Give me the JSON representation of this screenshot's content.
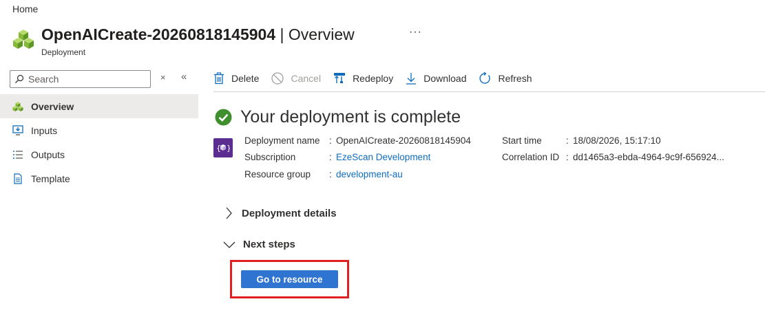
{
  "breadcrumb": "Home",
  "header": {
    "resource_name": "OpenAICreate-20260818145904",
    "separator": " | ",
    "page_name": "Overview",
    "subtitle": "Deployment",
    "more": "···"
  },
  "search": {
    "placeholder": "Search",
    "clear": "×",
    "collapse": "«"
  },
  "sidebar": {
    "items": [
      {
        "label": "Overview",
        "icon": "overview-icon",
        "active": true
      },
      {
        "label": "Inputs",
        "icon": "inputs-icon"
      },
      {
        "label": "Outputs",
        "icon": "outputs-icon"
      },
      {
        "label": "Template",
        "icon": "template-icon"
      }
    ]
  },
  "toolbar": {
    "delete": "Delete",
    "cancel": "Cancel",
    "redeploy": "Redeploy",
    "download": "Download",
    "refresh": "Refresh"
  },
  "status": {
    "message": "Your deployment is complete"
  },
  "details": {
    "deployment_name_label": "Deployment name",
    "deployment_name": "OpenAICreate-20260818145904",
    "subscription_label": "Subscription",
    "subscription": "EzeScan Development",
    "resource_group_label": "Resource group",
    "resource_group": "development-au",
    "start_time_label": "Start time",
    "start_time": "18/08/2026, 15:17:10",
    "correlation_id_label": "Correlation ID",
    "correlation_id": "dd1465a3-ebda-4964-9c9f-656924...",
    "colon": ":"
  },
  "sections": {
    "deployment_details": "Deployment details",
    "next_steps": "Next steps"
  },
  "go_to_resource": "Go to resource",
  "colors": {
    "accent": "#0f6cbd",
    "success": "#3f8f2f",
    "button": "#2f74d0",
    "highlight": "#e02020",
    "deployment_icon": "#5c2d91"
  }
}
